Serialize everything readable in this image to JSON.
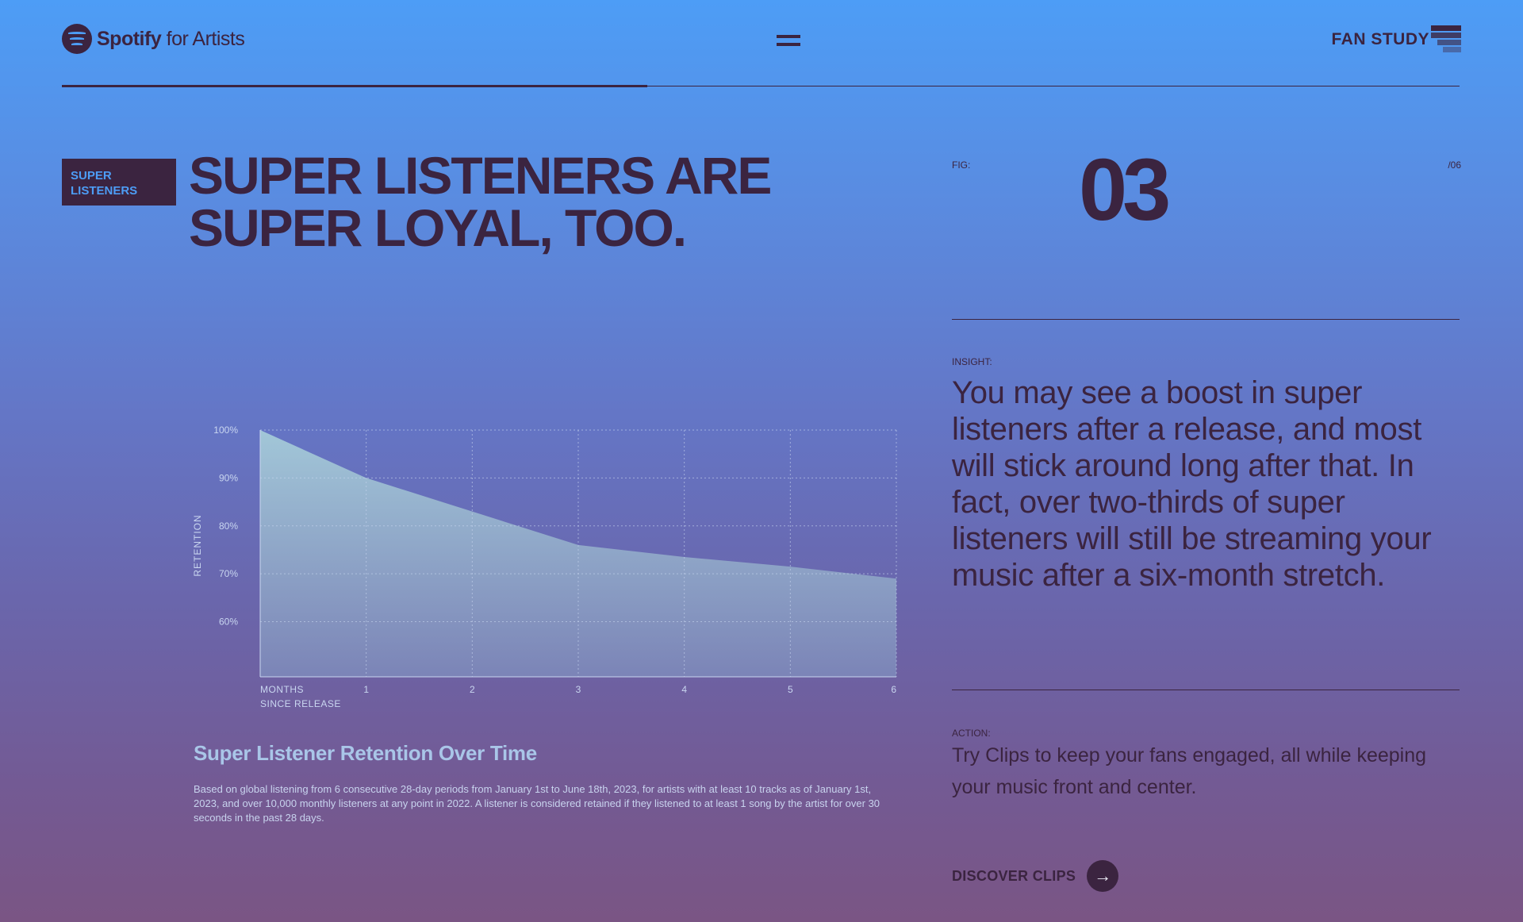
{
  "header": {
    "logo_brand": "Spotify",
    "logo_suffix": "for Artists",
    "section_label": "FAN STUDY",
    "menu_icon": "hamburger-menu-icon",
    "section_icon": "fan-study-stripes-icon"
  },
  "badge": {
    "line1": "SUPER",
    "line2": "LISTENERS"
  },
  "headline": {
    "line1": "SUPER LISTENERS ARE",
    "line2": "SUPER LOYAL, TOO."
  },
  "figure": {
    "label": "FIG:",
    "number": "03",
    "total": "/06"
  },
  "insight": {
    "label": "INSIGHT:",
    "text": "You may see a boost in super listeners after a release, and most will stick around long after that. In fact, over two-thirds of super listeners will still be streaming your music after a six-month stretch."
  },
  "action": {
    "label": "ACTION:",
    "text": "Try Clips to keep your fans engaged, all while keeping your music front and center.",
    "link_label": "DISCOVER CLIPS",
    "link_icon": "arrow-right-icon"
  },
  "caption": {
    "title": "Super Listener Retention Over Time",
    "description": "Based on global listening from 6 consecutive 28-day periods from January 1st to June 18th, 2023, for artists with at least 10 tracks as of January 1st, 2023, and over 10,000 monthly listeners at any point in 2022. A listener is considered retained if they listened to at least 1 song by the artist for over 30 seconds in the past 28 days."
  },
  "colors": {
    "ink": "#3b2440",
    "accent_blue": "#4d9df6",
    "area_top": "#a5cbd9",
    "area_bottom": "#7c86b8"
  },
  "chart_data": {
    "type": "area",
    "title": "Super Listener Retention Over Time",
    "xlabel": "MONTHS SINCE RELEASE",
    "xlabel_lines": [
      "MONTHS",
      "SINCE RELEASE"
    ],
    "ylabel": "RETENTION",
    "x": [
      0,
      1,
      2,
      3,
      4,
      5,
      6
    ],
    "x_tick_labels": [
      "1",
      "2",
      "3",
      "4",
      "5",
      "6"
    ],
    "y_tick_labels": [
      "100%",
      "90%",
      "80%",
      "70%",
      "60%"
    ],
    "y_ticks": [
      100,
      90,
      80,
      70,
      60
    ],
    "ylim": [
      48.5,
      100
    ],
    "series": [
      {
        "values": [
          100,
          90,
          83,
          76,
          73.5,
          71.5,
          69
        ]
      }
    ],
    "grid": true
  }
}
